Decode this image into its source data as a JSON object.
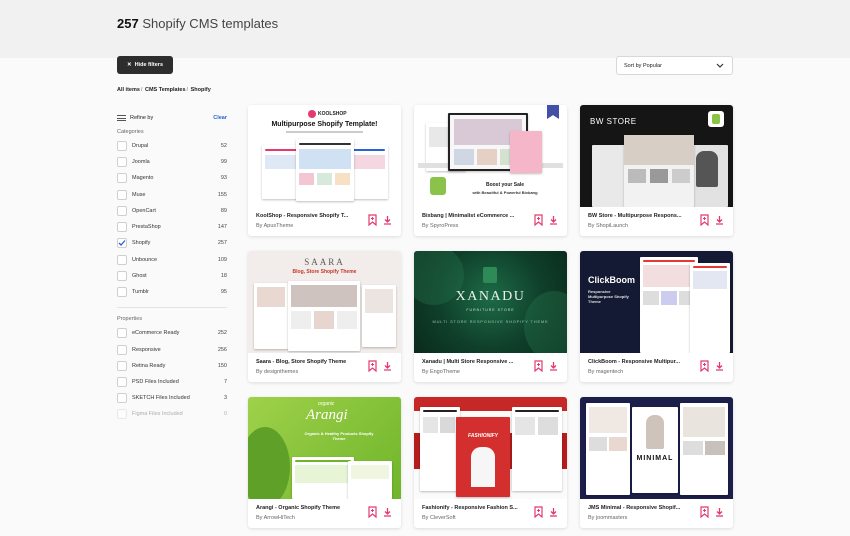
{
  "header": {
    "count": "257",
    "title_rest": "Shopify CMS templates"
  },
  "toolbar": {
    "hide_filters_label": "Hide filters",
    "hide_filters_icon": "✕",
    "sort_label": "Sort by Popular"
  },
  "breadcrumb": [
    "All items",
    "CMS Templates",
    "Shopify"
  ],
  "refine": {
    "label": "Refine by",
    "clear": "Clear"
  },
  "categories": {
    "label": "Categories",
    "items": [
      {
        "label": "Drupal",
        "count": "52",
        "checked": false
      },
      {
        "label": "Joomla",
        "count": "99",
        "checked": false
      },
      {
        "label": "Magento",
        "count": "93",
        "checked": false
      },
      {
        "label": "Muse",
        "count": "155",
        "checked": false
      },
      {
        "label": "OpenCart",
        "count": "89",
        "checked": false
      },
      {
        "label": "PrestaShop",
        "count": "147",
        "checked": false
      },
      {
        "label": "Shopify",
        "count": "257",
        "checked": true
      },
      {
        "label": "Unbounce",
        "count": "109",
        "checked": false
      },
      {
        "label": "Ghost",
        "count": "18",
        "checked": false
      },
      {
        "label": "Tumblr",
        "count": "95",
        "checked": false
      }
    ]
  },
  "properties": {
    "label": "Properties",
    "items": [
      {
        "label": "eCommerce Ready",
        "count": "252"
      },
      {
        "label": "Responsive",
        "count": "256"
      },
      {
        "label": "Retina Ready",
        "count": "150"
      },
      {
        "label": "PSD Files Included",
        "count": "7"
      },
      {
        "label": "SKETCH Files Included",
        "count": "3"
      },
      {
        "label": "Figma Files Included",
        "count": "0"
      }
    ]
  },
  "cards": [
    {
      "title": "KoolShop - Responsive Shopify T...",
      "author": "By ApusTheme",
      "thumb": {
        "logo": "KOOLSHOP",
        "headline": "Multipurpose Shopify Template!"
      }
    },
    {
      "title": "Bixbang | Minimalist eCommerce ...",
      "author": "By SpyroPress",
      "thumb": {
        "headline": "Boost your Sale",
        "sub": "with Beautiful & Powerful Bixbang"
      }
    },
    {
      "title": "BW Store - Multipurpose Respons...",
      "author": "By ShopiLaunch",
      "thumb": {
        "logo": "BW STORE"
      }
    },
    {
      "title": "Saara - Blog, Store Shopify Theme",
      "author": "By designthemes",
      "thumb": {
        "logo": "SAARA",
        "headline": "Blog, Store Shopify Theme"
      }
    },
    {
      "title": "Xanadu | Multi Store Responsive ...",
      "author": "By EngoTheme",
      "thumb": {
        "logo": "XANADU",
        "tag": "FURNITURE STORE",
        "sub": "MULTI STORE RESPONSIVE SHOPIFY THEME"
      }
    },
    {
      "title": "ClickBoom - Responsive Multipur...",
      "author": "By magentech",
      "thumb": {
        "logo": "ClickBoom",
        "headline": "Responsive Multipurpose Shopify Theme"
      }
    },
    {
      "title": "Arangi - Organic Shopify Theme",
      "author": "By ArrowHiTech",
      "thumb": {
        "logo": "Arangi",
        "tag": "organic",
        "headline": "Organic & Healthy Products Shopify Theme"
      }
    },
    {
      "title": "Fashionify - Responsive Fashion S...",
      "author": "By CleverSoft",
      "thumb": {
        "logo": "FASHIONIFY"
      }
    },
    {
      "title": "JMS Minimal - Responsive Shopif...",
      "author": "By joommasters",
      "thumb": {
        "logo": "MINIMAL"
      }
    }
  ],
  "colors": {
    "accent": "#2a62d8",
    "pink": "#e5396e",
    "dark_button": "#2d2d2d"
  }
}
